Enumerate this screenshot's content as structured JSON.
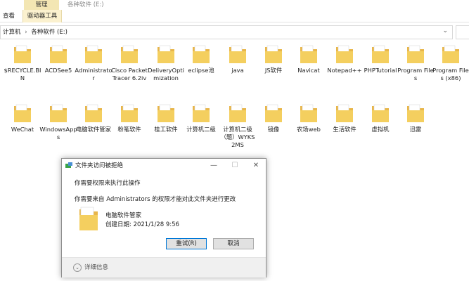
{
  "ribbon": {
    "manage_tab": "管理",
    "window_title": "各种软件 (E:)",
    "tab_view": "查看",
    "tab_drive_tools": "驱动器工具"
  },
  "address": {
    "crumb_root": "计算机",
    "separator": "›",
    "crumb_drive": "各种软件 (E:)",
    "chevron_icon": "chevron-down-icon"
  },
  "folders": [
    {
      "label": "$RECYCLE.BIN",
      "icon": "folder-icon"
    },
    {
      "label": "ACDSee5",
      "icon": "folder-icon"
    },
    {
      "label": "Administrator",
      "icon": "folder-icon"
    },
    {
      "label": "Cisco Packet Tracer 6.2iv",
      "icon": "folder-icon"
    },
    {
      "label": "DeliveryOptimization",
      "icon": "folder-icon"
    },
    {
      "label": "eclipse池",
      "icon": "folder-icon"
    },
    {
      "label": "java",
      "icon": "folder-icon"
    },
    {
      "label": "JS软件",
      "icon": "folder-icon"
    },
    {
      "label": "Navicat",
      "icon": "folder-icon"
    },
    {
      "label": "Notepad++",
      "icon": "folder-icon"
    },
    {
      "label": "PHPTutorial",
      "icon": "folder-icon"
    },
    {
      "label": "Program Files",
      "icon": "folder-icon"
    },
    {
      "label": "Program Files (x86)",
      "icon": "folder-icon"
    },
    {
      "label": "WeChat",
      "icon": "folder-icon"
    },
    {
      "label": "WindowsApps",
      "icon": "folder-icon"
    },
    {
      "label": "电脑软件管家",
      "icon": "folder-icon"
    },
    {
      "label": "粉笔软件",
      "icon": "folder-icon"
    },
    {
      "label": "桂工软件",
      "icon": "folder-icon"
    },
    {
      "label": "计算机二级",
      "icon": "folder-icon"
    },
    {
      "label": "计算机二级（题）WYKS2MS",
      "icon": "folder-icon"
    },
    {
      "label": "镜像",
      "icon": "folder-icon"
    },
    {
      "label": "农场web",
      "icon": "folder-icon"
    },
    {
      "label": "生活软件",
      "icon": "folder-icon"
    },
    {
      "label": "虚拟机",
      "icon": "folder-icon"
    },
    {
      "label": "迅雷",
      "icon": "folder-icon"
    }
  ],
  "dialog": {
    "title": "文件夹访问被拒绝",
    "minimize": "—",
    "maximize": "☐",
    "close": "✕",
    "line1": "你需要权限来执行此操作",
    "line2": "你需要来自 Administrators 的权限才能对此文件夹进行更改",
    "folder_name": "电脑软件管家",
    "created_date": "创建日期: 2021/1/28 9:56",
    "retry": "重试(R)",
    "cancel": "取消",
    "details": "详细信息",
    "details_icon": "chevron-down-circle-icon"
  },
  "colors": {
    "folder_yellow": "#f4cf5f",
    "folder_back": "#e8b64a",
    "manage_tab_bg": "#f3e6b3",
    "accent_blue": "#0078d7"
  }
}
